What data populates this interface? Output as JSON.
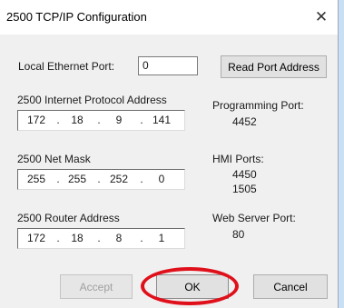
{
  "window": {
    "title": "2500 TCP/IP Configuration",
    "close_glyph": "✕"
  },
  "local_port": {
    "label": "Local Ethernet Port:",
    "value": "0",
    "read_button": "Read Port Address"
  },
  "ip_address": {
    "label": "2500 Internet Protocol Address",
    "octets": [
      "172",
      "18",
      "9",
      "141"
    ]
  },
  "net_mask": {
    "label": "2500 Net Mask",
    "octets": [
      "255",
      "255",
      "252",
      "0"
    ]
  },
  "router": {
    "label": "2500 Router Address",
    "octets": [
      "172",
      "18",
      "8",
      "1"
    ]
  },
  "programming_port": {
    "label": "Programming Port:",
    "value": "4452"
  },
  "hmi_ports": {
    "label": "HMI Ports:",
    "values": [
      "4450",
      "1505"
    ]
  },
  "web_server_port": {
    "label": "Web Server Port:",
    "value": "80"
  },
  "buttons": {
    "accept": "Accept",
    "ok": "OK",
    "cancel": "Cancel"
  },
  "colors": {
    "highlight": "#e0101b",
    "dialog_bg": "#f0f0f0",
    "backdrop": "#c9dff3"
  }
}
